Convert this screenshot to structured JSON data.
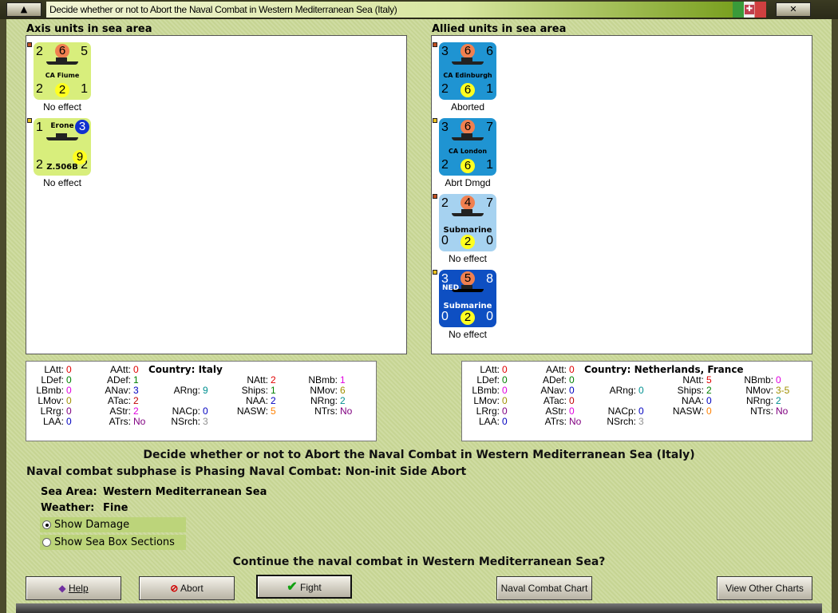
{
  "window": {
    "title": "Decide whether or not to Abort the Naval Combat in Western Mediterranean Sea (Italy)",
    "flag_icon": "italy-flag-icon"
  },
  "axis": {
    "header": "Axis units in sea area",
    "units": [
      {
        "name": "CA Fiume",
        "tl": "2",
        "tc": "6",
        "tr": "5",
        "bl": "2",
        "bc": "2",
        "br": "1",
        "status": "No effect",
        "bg": "#d8ee7c"
      },
      {
        "name": "Z.506B",
        "label": "Erone",
        "tl": "1",
        "tc": "3",
        "tr": "",
        "bl": "2",
        "bc": "9",
        "br": "2",
        "status": "No effect",
        "bg": "#d8ee7c"
      }
    ]
  },
  "allied": {
    "header": "Allied units in sea area",
    "units": [
      {
        "name": "CA Edinburgh",
        "tl": "3",
        "tc": "6",
        "tr": "6",
        "bl": "2",
        "bc": "6",
        "br": "1",
        "status": "Aborted",
        "bg": "#1f94d2"
      },
      {
        "name": "CA London",
        "tl": "3",
        "tc": "6",
        "tr": "7",
        "bl": "2",
        "bc": "6",
        "br": "1",
        "status": "Abrt Dmgd",
        "bg": "#1f94d2"
      },
      {
        "name": "Submarine",
        "tl": "2",
        "tc": "4",
        "tr": "7",
        "bl": "0",
        "bc": "2",
        "br": "0",
        "status": "No effect",
        "bg": "#a6d2f0"
      },
      {
        "name": "Submarine",
        "label": "NED",
        "tl": "3",
        "tc": "5",
        "tr": "8",
        "bl": "0",
        "bc": "2",
        "br": "0",
        "status": "No effect",
        "bg": "#0e4fc2"
      }
    ]
  },
  "axis_stats": {
    "country": "Country: Italy",
    "items": [
      {
        "l": "LAtt:",
        "v": "0",
        "c": "#e00000"
      },
      {
        "l": "AAtt:",
        "v": "0",
        "c": "#e00000"
      },
      {
        "l": "LDef:",
        "v": "0",
        "c": "#008000"
      },
      {
        "l": "ADef:",
        "v": "1",
        "c": "#008000"
      },
      {
        "l": "NAtt:",
        "v": "2",
        "c": "#e00000"
      },
      {
        "l": "NBmb:",
        "v": "1",
        "c": "#e000e0"
      },
      {
        "l": "LBmb:",
        "v": "0",
        "c": "#e000e0"
      },
      {
        "l": "ANav:",
        "v": "3",
        "c": "#0000c0"
      },
      {
        "l": "ARng:",
        "v": "9",
        "c": "#009090"
      },
      {
        "l": "Ships:",
        "v": "1",
        "c": "#008000"
      },
      {
        "l": "NMov:",
        "v": "6",
        "c": "#a09000"
      },
      {
        "l": "LMov:",
        "v": "0",
        "c": "#a09000"
      },
      {
        "l": "ATac:",
        "v": "2",
        "c": "#c00000"
      },
      {
        "l": "NAA:",
        "v": "2",
        "c": "#0000c0"
      },
      {
        "l": "NRng:",
        "v": "2",
        "c": "#009090"
      },
      {
        "l": "LRrg:",
        "v": "0",
        "c": "#800080"
      },
      {
        "l": "AStr:",
        "v": "2",
        "c": "#e000e0"
      },
      {
        "l": "NACp:",
        "v": "0",
        "c": "#0000c0"
      },
      {
        "l": "NASW:",
        "v": "5",
        "c": "#ff8000"
      },
      {
        "l": "NTrs:",
        "v": "No",
        "c": "#800080"
      },
      {
        "l": "LAA:",
        "v": "0",
        "c": "#0000c0"
      },
      {
        "l": "ATrs:",
        "v": "No",
        "c": "#800080"
      },
      {
        "l": "NSrch:",
        "v": "3",
        "c": "#909090"
      }
    ]
  },
  "allied_stats": {
    "country": "Country: Netherlands, France",
    "items": [
      {
        "l": "LAtt:",
        "v": "0",
        "c": "#e00000"
      },
      {
        "l": "AAtt:",
        "v": "0",
        "c": "#e00000"
      },
      {
        "l": "LDef:",
        "v": "0",
        "c": "#008000"
      },
      {
        "l": "ADef:",
        "v": "0",
        "c": "#008000"
      },
      {
        "l": "NAtt:",
        "v": "5",
        "c": "#e00000"
      },
      {
        "l": "NBmb:",
        "v": "0",
        "c": "#e000e0"
      },
      {
        "l": "LBmb:",
        "v": "0",
        "c": "#e000e0"
      },
      {
        "l": "ANav:",
        "v": "0",
        "c": "#0000c0"
      },
      {
        "l": "ARng:",
        "v": "0",
        "c": "#009090"
      },
      {
        "l": "Ships:",
        "v": "2",
        "c": "#008000"
      },
      {
        "l": "NMov:",
        "v": "3-5",
        "c": "#a09000"
      },
      {
        "l": "LMov:",
        "v": "0",
        "c": "#a09000"
      },
      {
        "l": "ATac:",
        "v": "0",
        "c": "#c00000"
      },
      {
        "l": "NAA:",
        "v": "0",
        "c": "#0000c0"
      },
      {
        "l": "NRng:",
        "v": "2",
        "c": "#009090"
      },
      {
        "l": "LRrg:",
        "v": "0",
        "c": "#800080"
      },
      {
        "l": "AStr:",
        "v": "0",
        "c": "#e000e0"
      },
      {
        "l": "NACp:",
        "v": "0",
        "c": "#0000c0"
      },
      {
        "l": "NASW:",
        "v": "0",
        "c": "#ff8000"
      },
      {
        "l": "NTrs:",
        "v": "No",
        "c": "#800080"
      },
      {
        "l": "LAA:",
        "v": "0",
        "c": "#0000c0"
      },
      {
        "l": "ATrs:",
        "v": "No",
        "c": "#800080"
      },
      {
        "l": "NSrch:",
        "v": "3",
        "c": "#909090"
      }
    ]
  },
  "main": {
    "heading": "Decide whether or not to Abort the Naval Combat in Western Mediterranean Sea (Italy)",
    "subphase": "Naval combat subphase is Phasing Naval Combat: Non-init Side Abort",
    "sea_area_label": "Sea Area:",
    "sea_area": "Western Mediterranean Sea",
    "weather_label": "Weather:",
    "weather": "Fine",
    "show_damage": "Show Damage",
    "show_sections": "Show Sea Box Sections",
    "question": "Continue the naval combat in Western Mediterranean Sea?"
  },
  "buttons": {
    "help": "Help",
    "abort": "Abort",
    "fight": "Fight",
    "naval_chart": "Naval Combat Chart",
    "other_charts": "View Other Charts"
  }
}
